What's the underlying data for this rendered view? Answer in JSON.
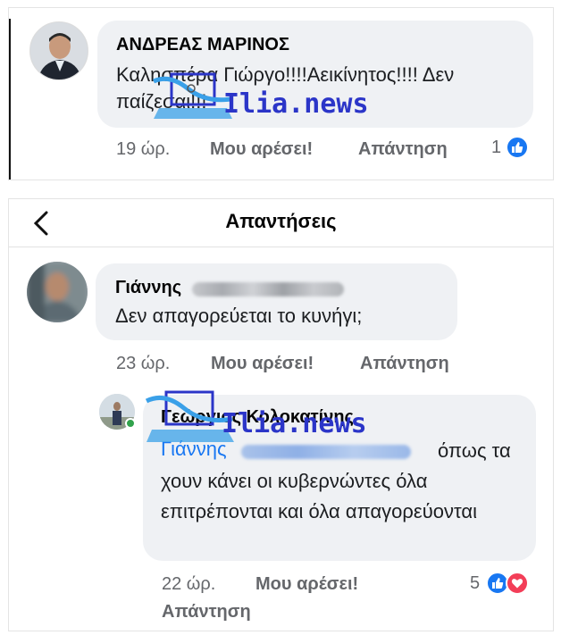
{
  "comment_main": {
    "author": "ΑΝΔΡΕΑΣ ΜΑΡΙΝΟΣ",
    "text": "Καλησπέρα Γιώργο!!!!Αεικίνητος!!!! Δεν παίζεσαι!!!",
    "time": "19 ώρ.",
    "like_label": "Μου αρέσει!",
    "reply_label": "Απάντηση",
    "reaction_count": "1"
  },
  "replies_panel": {
    "title": "Απαντήσεις",
    "comment": {
      "author": "Γιάννης",
      "text": "Δεν απαγορεύεται το κυνήγι;",
      "time": "23 ώρ.",
      "like_label": "Μου αρέσει!",
      "reply_label": "Απάντηση"
    },
    "reply": {
      "author": "Γεώργιος Κολοκατίνης",
      "mention": "Γιάννης",
      "text": "όπως τα χουν κάνει οι κυβερνώντες όλα επιτρέπονται και όλα απαγορεύονται",
      "time": "22 ώρ.",
      "like_label": "Μου αρέσει!",
      "reply_label": "Απάντηση",
      "reaction_count": "5"
    }
  },
  "watermark": {
    "text": "Ilia.news"
  },
  "colors": {
    "bubble": "#eff1f4",
    "meta_text": "#65676b",
    "like_blue": "#1877f2",
    "love_red": "#f33e58",
    "watermark": "#2b35c8"
  },
  "icons": [
    "back-arrow-icon",
    "like-icon",
    "love-icon",
    "online-status-icon"
  ]
}
